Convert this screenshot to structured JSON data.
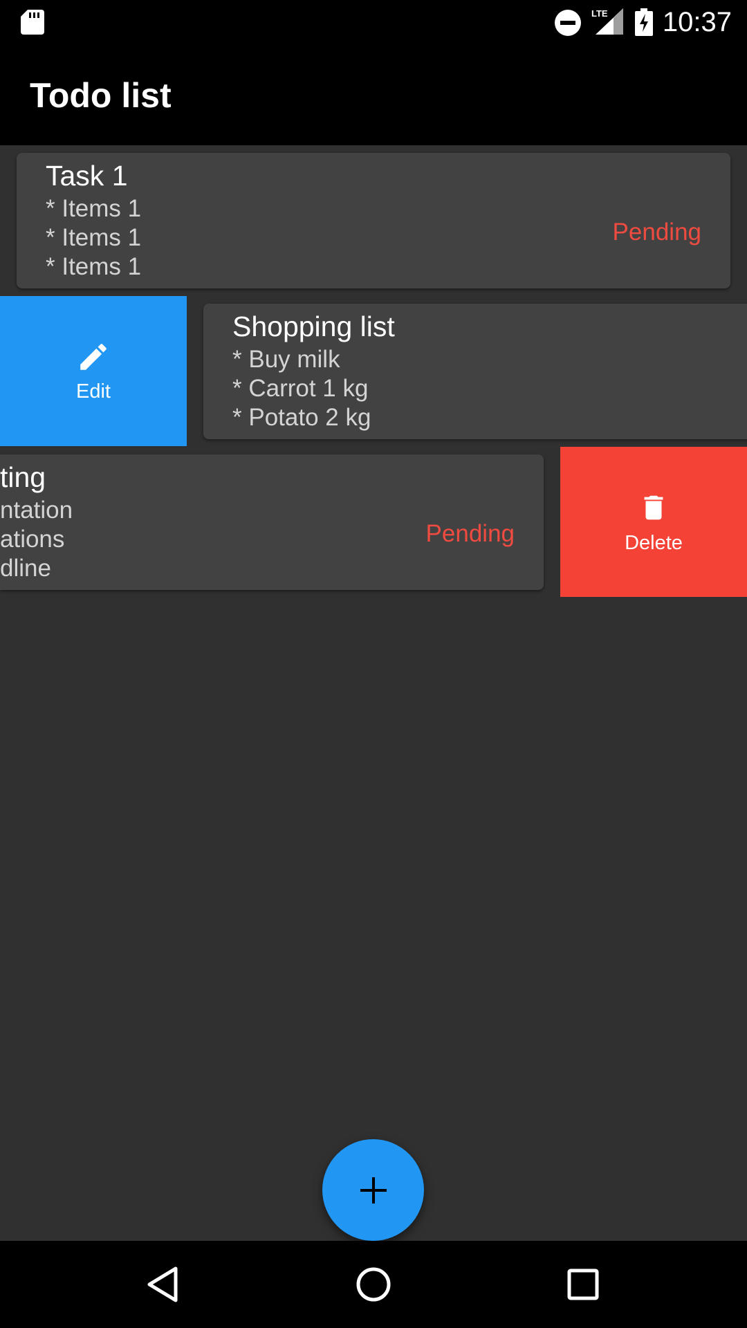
{
  "status_bar": {
    "time": "10:37",
    "icons": [
      "sd-card-icon",
      "do-not-disturb-icon",
      "lte-signal-icon",
      "battery-charging-icon"
    ],
    "network_label": "LTE"
  },
  "app_bar": {
    "title": "Todo list"
  },
  "cards": [
    {
      "title": "Task 1",
      "items": [
        "* Items 1",
        "* Items 1",
        "* Items 1"
      ],
      "status": "Pending"
    },
    {
      "title": "Shopping list",
      "items": [
        "* Buy milk",
        "* Carrot 1 kg",
        "* Potato 2 kg"
      ]
    },
    {
      "title": "ting",
      "items": [
        "ntation",
        "ations",
        "dline"
      ],
      "status": "Pending"
    }
  ],
  "actions": {
    "edit_label": "Edit",
    "delete_label": "Delete"
  },
  "fab": {
    "icon": "plus-icon"
  },
  "nav": {
    "icons": [
      "back-icon",
      "home-icon",
      "recents-icon"
    ]
  },
  "colors": {
    "background": "#303030",
    "card": "#424242",
    "edit": "#2196f3",
    "delete": "#f44336",
    "pending": "#f04b40",
    "fab": "#2196f3"
  }
}
